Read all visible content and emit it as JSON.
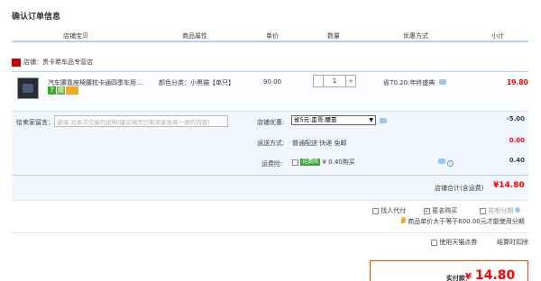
{
  "page_title": "确认订单信息",
  "columns": [
    "店铺宝贝",
    "商品属性",
    "单价",
    "数量",
    "优惠方式",
    "小计"
  ],
  "shop": {
    "name": "店铺：贵卡希车品专营店"
  },
  "item": {
    "name": "汽车腰靠座椅腰枕卡通四季车用...",
    "badges": [
      "7",
      "赠"
    ],
    "attribute": "颜色分类：小黑猫【单只】",
    "unit_price": "90.00",
    "quantity": "1",
    "minus": "-",
    "plus": "+",
    "promotion": "省70.20:年终盛典",
    "subtotal": "19.80"
  },
  "seller_message": {
    "label": "给卖家留言：",
    "placeholder": "选填:对本次交易的说明(建议填写已和卖家协商一致的内容)"
  },
  "shop_discount": {
    "label": "店铺优惠:",
    "selected": "省5元:歪哥:腰靠",
    "value": "-5.00"
  },
  "shipping": {
    "label": "运送方式:",
    "value": "普通配送 快递 免邮",
    "fee": "0.00"
  },
  "insurance": {
    "label": "运费险:",
    "badge": "运费险",
    "text": "¥ 0.40购买",
    "value": "0.40"
  },
  "shop_total": {
    "label": "店铺合计(含运费)",
    "value": "¥14.80"
  },
  "options": {
    "proxy_pay": "找人代付",
    "anonymous": "匿名购买",
    "huabei": "花呗分期",
    "huabei_note": "商品单价大于等于600.00元才能使用分期",
    "tmall_coupon": "使用天猫点券",
    "settle": "结算时扣除"
  },
  "pay": {
    "label": "实付款：",
    "currency": "¥",
    "value": "14.80"
  },
  "colors": {
    "accent_red": "#ff0000",
    "border_blue": "#b2d1ff",
    "pay_border": "#ff4a00"
  }
}
